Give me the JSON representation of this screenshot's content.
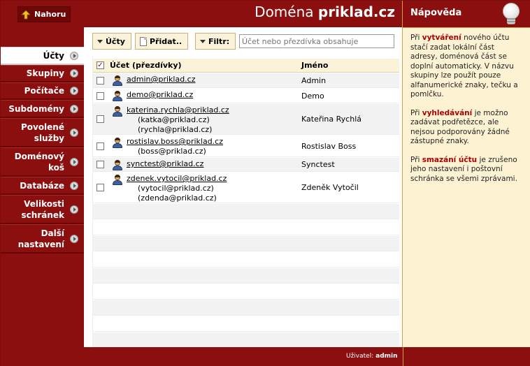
{
  "header": {
    "up_button_label": "Nahoru",
    "domain_prefix": "Doména",
    "domain_name": "priklad.cz"
  },
  "sidebar": {
    "items": [
      {
        "label": "Účty",
        "active": true
      },
      {
        "label": "Skupiny"
      },
      {
        "label": "Počítače"
      },
      {
        "label": "Subdomény"
      },
      {
        "label": "Povolené služby"
      },
      {
        "label": "Doménový koš"
      },
      {
        "label": "Databáze"
      },
      {
        "label": "Velikosti schránek"
      },
      {
        "label": "Další nastavení"
      }
    ]
  },
  "toolbar": {
    "accounts_label": "Účty",
    "add_label": "Přidat..",
    "filter_label": "Filtr:",
    "filter_placeholder": "Účet nebo přezdívka obsahuje",
    "filter_value": ""
  },
  "table": {
    "col_account": "Účet (přezdívky)",
    "col_name": "Jméno",
    "header_checked": true,
    "rows": [
      {
        "account": "admin@priklad.cz",
        "aliases": [],
        "name": "Admin"
      },
      {
        "account": "demo@priklad.cz",
        "aliases": [],
        "name": "Demo"
      },
      {
        "account": "katerina.rychla@priklad.cz",
        "aliases": [
          "(katka@priklad.cz)",
          "(rychla@priklad.cz)"
        ],
        "name": "Kateřina Rychlá"
      },
      {
        "account": "rostislav.boss@priklad.cz",
        "aliases": [
          "(boss@priklad.cz)"
        ],
        "name": "Rostislav Boss"
      },
      {
        "account": "synctest@priklad.cz",
        "aliases": [],
        "name": "Synctest"
      },
      {
        "account": "zdenek.vytocil@priklad.cz",
        "aliases": [
          "(vytocil@priklad.cz)",
          "(zdenda@priklad.cz)"
        ],
        "name": "Zdeněk Vytočil"
      }
    ]
  },
  "help": {
    "title": "Nápověda",
    "p1_pre": "Při ",
    "p1_hl": "vytváření",
    "p1_post": " nového účtu stačí zadat lokální část adresy, doménová část se doplní automaticky. V názvu skupiny lze použít pouze alfanumerické znaky, tečku a pomlčku.",
    "p2_pre": "Při ",
    "p2_hl": "vyhledávání",
    "p2_post": " je možno zadávat podřetězce, ale nejsou podporovány žádné zástupné znaky.",
    "p3_pre": "Při ",
    "p3_hl": "smazání účtu",
    "p3_post": " je zrušeno jeho nastavení i poštovní schránka se všemi zprávami."
  },
  "footer": {
    "user_label": "Uživatel:",
    "user_value": "admin"
  }
}
